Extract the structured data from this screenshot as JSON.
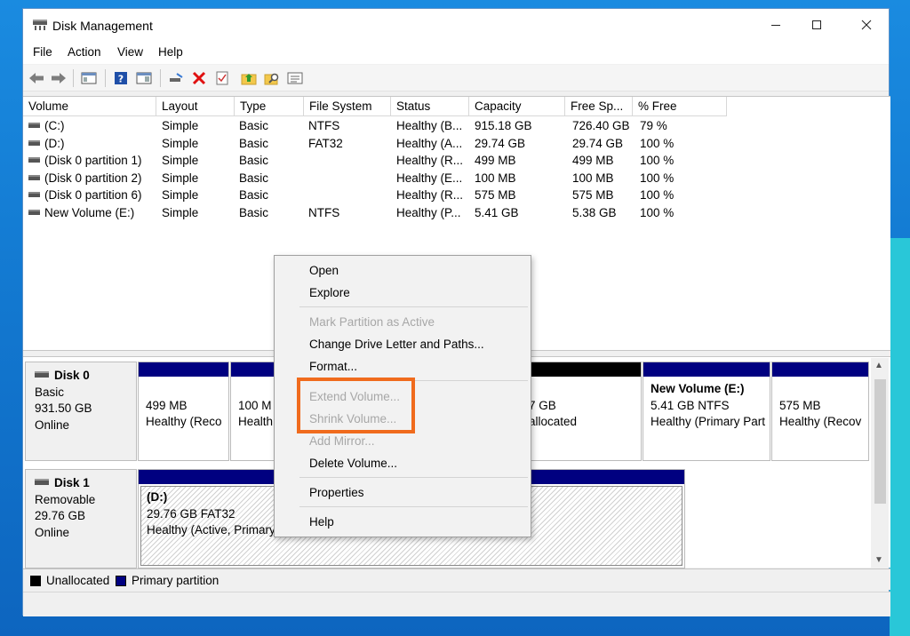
{
  "window": {
    "title": "Disk Management",
    "icon": "disk-management-icon"
  },
  "menubar": {
    "items": [
      "File",
      "Action",
      "View",
      "Help"
    ]
  },
  "toolbar": {
    "buttons": [
      "back-arrow-icon",
      "forward-arrow-icon",
      "console-tree-icon",
      "help-icon",
      "show-hide-icon",
      "connect-drive-icon",
      "delete-red-x-icon",
      "properties-check-icon",
      "folder-arrow-icon",
      "search-folder-icon",
      "list-view-icon"
    ]
  },
  "volume_list": {
    "columns": [
      "Volume",
      "Layout",
      "Type",
      "File System",
      "Status",
      "Capacity",
      "Free Sp...",
      "% Free"
    ],
    "rows": [
      {
        "volume": "(C:)",
        "layout": "Simple",
        "type": "Basic",
        "fs": "NTFS",
        "status": "Healthy (B...",
        "capacity": "915.18 GB",
        "free": "726.40 GB",
        "pct": "79 %"
      },
      {
        "volume": "(D:)",
        "layout": "Simple",
        "type": "Basic",
        "fs": "FAT32",
        "status": "Healthy (A...",
        "capacity": "29.74 GB",
        "free": "29.74 GB",
        "pct": "100 %"
      },
      {
        "volume": "(Disk 0 partition 1)",
        "layout": "Simple",
        "type": "Basic",
        "fs": "",
        "status": "Healthy (R...",
        "capacity": "499 MB",
        "free": "499 MB",
        "pct": "100 %"
      },
      {
        "volume": "(Disk 0 partition 2)",
        "layout": "Simple",
        "type": "Basic",
        "fs": "",
        "status": "Healthy (E...",
        "capacity": "100 MB",
        "free": "100 MB",
        "pct": "100 %"
      },
      {
        "volume": "(Disk 0 partition 6)",
        "layout": "Simple",
        "type": "Basic",
        "fs": "",
        "status": "Healthy (R...",
        "capacity": "575 MB",
        "free": "575 MB",
        "pct": "100 %"
      },
      {
        "volume": "New Volume (E:)",
        "layout": "Simple",
        "type": "Basic",
        "fs": "NTFS",
        "status": "Healthy (P...",
        "capacity": "5.41 GB",
        "free": "5.38 GB",
        "pct": "100 %"
      }
    ]
  },
  "disks": [
    {
      "name": "Disk 0",
      "kind": "Basic",
      "size": "931.50 GB",
      "state": "Online",
      "partitions": [
        {
          "line1": "",
          "line2": "499 MB",
          "line3": "Healthy (Reco"
        },
        {
          "line1": "",
          "line2": "100 M",
          "line3": "Health"
        },
        {
          "line1": "",
          "line2": "7 GB",
          "line3": "allocated"
        },
        {
          "line1": "New Volume  (E:)",
          "line2": "5.41 GB NTFS",
          "line3": "Healthy (Primary Part"
        },
        {
          "line1": "",
          "line2": "575 MB",
          "line3": "Healthy (Recov"
        }
      ]
    },
    {
      "name": "Disk 1",
      "kind": "Removable",
      "size": "29.76 GB",
      "state": "Online",
      "partitions": [
        {
          "line1": "(D:)",
          "line2": "29.76 GB FAT32",
          "line3": "Healthy (Active, Primary"
        }
      ]
    }
  ],
  "legend": [
    {
      "label": "Unallocated",
      "color": "#000000"
    },
    {
      "label": "Primary partition",
      "color": "#000080"
    }
  ],
  "context_menu": {
    "items": [
      {
        "label": "Open",
        "enabled": true
      },
      {
        "label": "Explore",
        "enabled": true
      },
      {
        "label": "Mark Partition as Active",
        "enabled": false
      },
      {
        "label": "Change Drive Letter and Paths...",
        "enabled": true
      },
      {
        "label": "Format...",
        "enabled": true
      },
      {
        "label": "Extend Volume...",
        "enabled": false
      },
      {
        "label": "Shrink Volume...",
        "enabled": false
      },
      {
        "label": "Add Mirror...",
        "enabled": false
      },
      {
        "label": "Delete Volume...",
        "enabled": true
      },
      {
        "label": "Properties",
        "enabled": true
      },
      {
        "label": "Help",
        "enabled": true
      }
    ],
    "highlight_color": "#f06b1d"
  },
  "colors": {
    "primary_partition": "#000080",
    "unallocated": "#000000",
    "highlight": "#f06b1d"
  }
}
